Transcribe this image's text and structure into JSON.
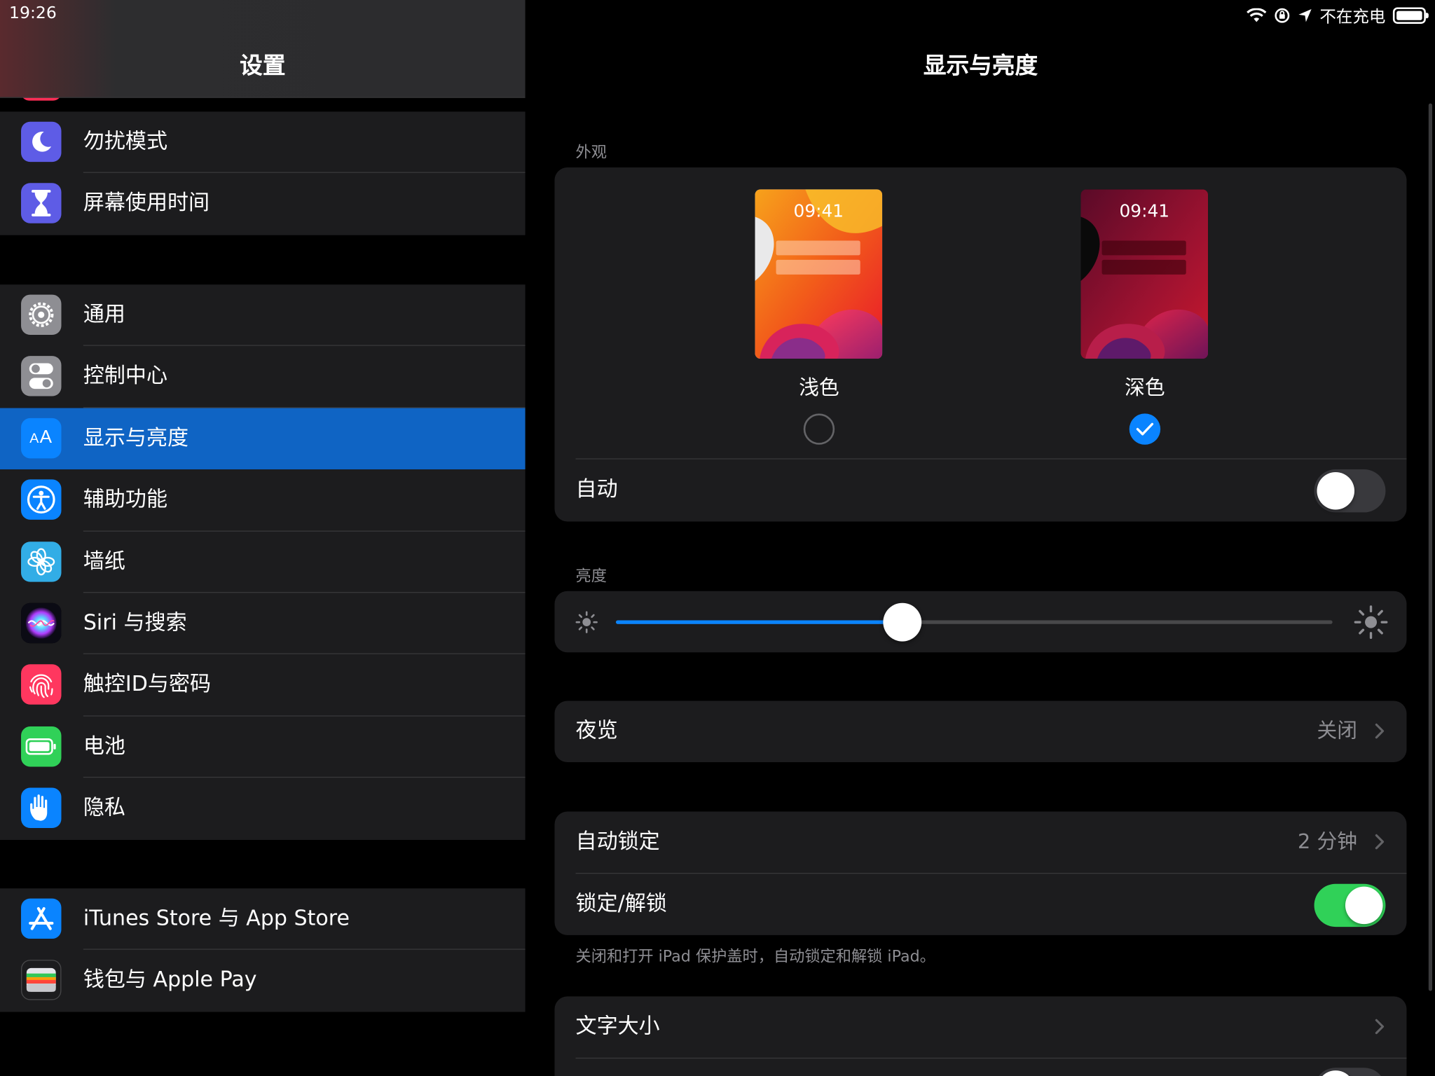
{
  "status": {
    "time": "19:26",
    "charging": "不在充电"
  },
  "sidebar": {
    "title": "设置",
    "groups": [
      [
        {
          "label": "勿扰模式",
          "icon": "moon-icon",
          "color": "#5e5ce6"
        },
        {
          "label": "屏幕使用时间",
          "icon": "hourglass-icon",
          "color": "#5e5ce6"
        }
      ],
      [
        {
          "label": "通用",
          "icon": "gear-icon",
          "color": "#8e8e93"
        },
        {
          "label": "控制中心",
          "icon": "switches-icon",
          "color": "#8e8e93"
        },
        {
          "label": "显示与亮度",
          "icon": "text-size-icon",
          "color": "#0a84ff",
          "selected": true,
          "glyph": "AA"
        },
        {
          "label": "辅助功能",
          "icon": "accessibility-icon",
          "color": "#0a84ff"
        },
        {
          "label": "墙纸",
          "icon": "flower-icon",
          "color": "#32ade6"
        },
        {
          "label": "Siri 与搜索",
          "icon": "siri-icon",
          "color": "#000000"
        },
        {
          "label": "触控ID与密码",
          "icon": "fingerprint-icon",
          "color": "#ff375f"
        },
        {
          "label": "电池",
          "icon": "battery-icon",
          "color": "#30d158"
        },
        {
          "label": "隐私",
          "icon": "hand-icon",
          "color": "#0a84ff"
        }
      ],
      [
        {
          "label": "iTunes Store 与 App Store",
          "icon": "app-store-icon",
          "color": "#0a84ff"
        },
        {
          "label": "钱包与 Apple Pay",
          "icon": "wallet-icon",
          "color": "#1c1c1e"
        }
      ]
    ]
  },
  "detail": {
    "title": "显示与亮度",
    "appearance": {
      "header": "外观",
      "light": {
        "label": "浅色",
        "time": "09:41"
      },
      "dark": {
        "label": "深色",
        "time": "09:41"
      },
      "selected": "dark",
      "auto_label": "自动",
      "auto_on": false
    },
    "brightness": {
      "header": "亮度",
      "value": 0.4
    },
    "night_shift": {
      "label": "夜览",
      "value": "关闭"
    },
    "auto_lock": {
      "label": "自动锁定",
      "value": "2 分钟"
    },
    "lock_unlock": {
      "label": "锁定/解锁",
      "on": true,
      "footer": "关闭和打开 iPad 保护盖时，自动锁定和解锁 iPad。"
    },
    "text_size": {
      "label": "文字大小"
    }
  }
}
